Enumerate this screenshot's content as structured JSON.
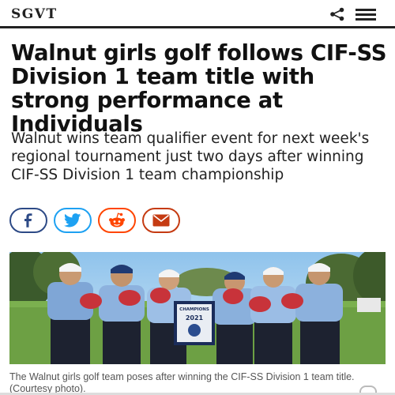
{
  "site": {
    "logo": "SGVT"
  },
  "header_icons": {
    "share": "share-icon",
    "menu": "hamburger-menu-icon"
  },
  "article": {
    "headline": "Walnut girls golf follows CIF-SS Division 1 team title with strong performance at Individuals",
    "subheadline": "Walnut wins team qualifier event for next week's regional tournament just two days after winning CIF-SS Division 1 team championship",
    "photo_caption": "The Walnut girls golf team poses after winning the CIF-SS Division 1 team title. (Courtesy photo).",
    "photo_plaque_title": "CHAMPIONS",
    "photo_plaque_year": "2021"
  },
  "share_buttons": [
    {
      "name": "facebook",
      "icon": "facebook-icon",
      "color": "#2d4a86"
    },
    {
      "name": "twitter",
      "icon": "twitter-icon",
      "color": "#1da1f2"
    },
    {
      "name": "reddit",
      "icon": "reddit-icon",
      "color": "#ff4500"
    },
    {
      "name": "email",
      "icon": "email-icon",
      "color": "#c53b12"
    }
  ]
}
